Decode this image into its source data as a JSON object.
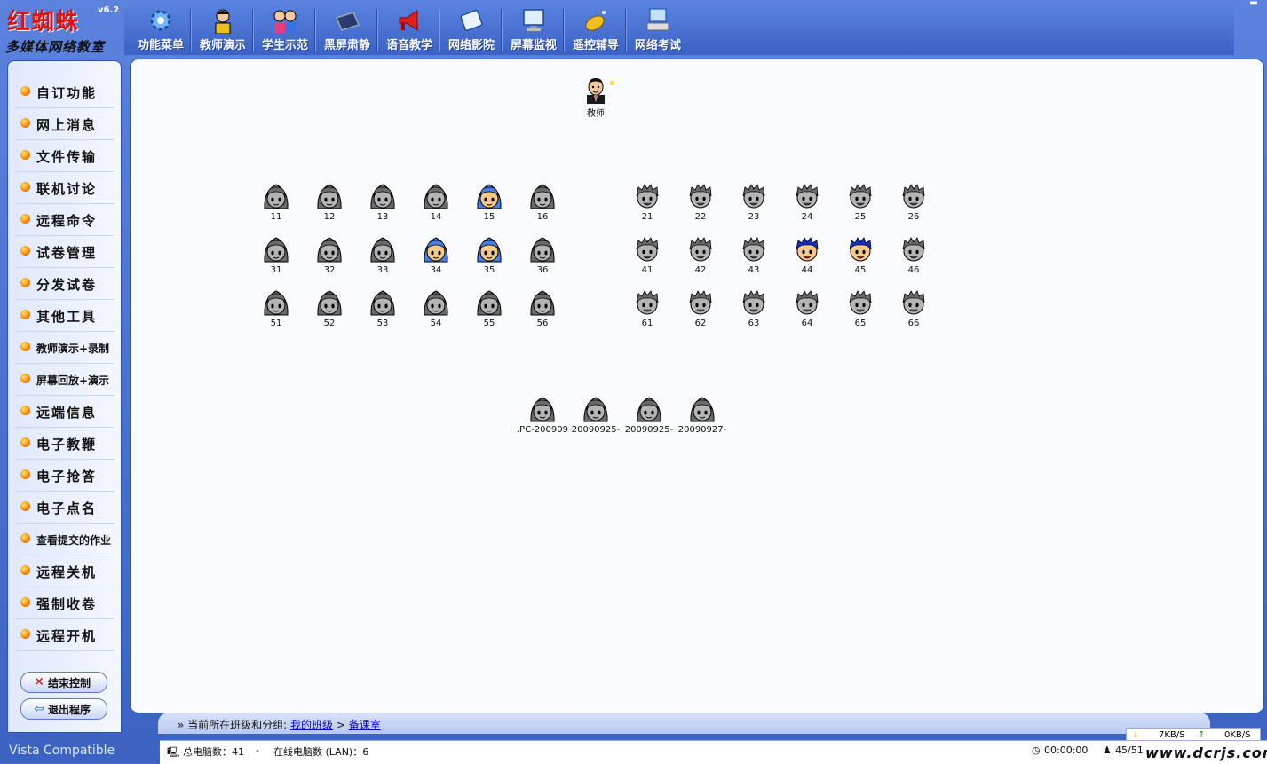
{
  "app": {
    "title": "红蜘蛛",
    "version": "v6.2",
    "subtitle": "多媒体网络教室",
    "footer": "Vista Compatible"
  },
  "toolbar": [
    {
      "label": "功能菜单",
      "icon": "gear-icon"
    },
    {
      "label": "教师演示",
      "icon": "teacher-icon"
    },
    {
      "label": "学生示范",
      "icon": "students-icon"
    },
    {
      "label": "黑屏肃静",
      "icon": "black-screen-icon"
    },
    {
      "label": "语音教学",
      "icon": "megaphone-icon"
    },
    {
      "label": "网络影院",
      "icon": "film-icon"
    },
    {
      "label": "屏幕监视",
      "icon": "monitor-icon"
    },
    {
      "label": "遥控辅导",
      "icon": "satellite-icon"
    },
    {
      "label": "网络考试",
      "icon": "exam-computer-icon"
    }
  ],
  "sidebar": {
    "items": [
      {
        "label": "自订功能",
        "small": false
      },
      {
        "label": "网上消息",
        "small": false
      },
      {
        "label": "文件传输",
        "small": false
      },
      {
        "label": "联机讨论",
        "small": false
      },
      {
        "label": "远程命令",
        "small": false
      },
      {
        "label": "试卷管理",
        "small": false
      },
      {
        "label": "分发试卷",
        "small": false
      },
      {
        "label": "其他工具",
        "small": false
      },
      {
        "label": "教师演示+录制",
        "small": true
      },
      {
        "label": "屏幕回放+演示",
        "small": true
      },
      {
        "label": "远端信息",
        "small": false
      },
      {
        "label": "电子教鞭",
        "small": false
      },
      {
        "label": "电子抢答",
        "small": false
      },
      {
        "label": "电子点名",
        "small": false
      },
      {
        "label": "查看提交的作业",
        "small": true
      },
      {
        "label": "远程关机",
        "small": false
      },
      {
        "label": "强制收卷",
        "small": false
      },
      {
        "label": "远程开机",
        "small": false
      }
    ],
    "end_button": "结束控制",
    "exit_button": "退出程序"
  },
  "teacher": {
    "label": "教师"
  },
  "desks": [
    {
      "label": "11",
      "type": "girl",
      "state": "offline"
    },
    {
      "label": "12",
      "type": "girl",
      "state": "offline"
    },
    {
      "label": "13",
      "type": "girl",
      "state": "offline"
    },
    {
      "label": "14",
      "type": "girl",
      "state": "offline"
    },
    {
      "label": "15",
      "type": "girl",
      "state": "online"
    },
    {
      "label": "16",
      "type": "girl",
      "state": "offline"
    },
    {
      "label": "31",
      "type": "girl",
      "state": "offline"
    },
    {
      "label": "32",
      "type": "girl",
      "state": "offline"
    },
    {
      "label": "33",
      "type": "girl",
      "state": "offline"
    },
    {
      "label": "34",
      "type": "girl",
      "state": "online"
    },
    {
      "label": "35",
      "type": "girl",
      "state": "online"
    },
    {
      "label": "36",
      "type": "girl",
      "state": "offline"
    },
    {
      "label": "51",
      "type": "girl",
      "state": "offline"
    },
    {
      "label": "52",
      "type": "girl",
      "state": "offline"
    },
    {
      "label": "53",
      "type": "girl",
      "state": "offline"
    },
    {
      "label": "54",
      "type": "girl",
      "state": "offline"
    },
    {
      "label": "55",
      "type": "girl",
      "state": "offline"
    },
    {
      "label": "56",
      "type": "girl",
      "state": "offline"
    },
    {
      "label": "21",
      "type": "boy",
      "state": "offline"
    },
    {
      "label": "22",
      "type": "boy",
      "state": "offline"
    },
    {
      "label": "23",
      "type": "boy",
      "state": "offline"
    },
    {
      "label": "24",
      "type": "boy",
      "state": "offline"
    },
    {
      "label": "25",
      "type": "boy",
      "state": "offline"
    },
    {
      "label": "26",
      "type": "boy",
      "state": "offline"
    },
    {
      "label": "41",
      "type": "boy",
      "state": "offline"
    },
    {
      "label": "42",
      "type": "boy",
      "state": "offline"
    },
    {
      "label": "43",
      "type": "boy",
      "state": "offline"
    },
    {
      "label": "44",
      "type": "boy",
      "state": "online"
    },
    {
      "label": "45",
      "type": "boy",
      "state": "online"
    },
    {
      "label": "46",
      "type": "boy",
      "state": "offline"
    },
    {
      "label": "61",
      "type": "boy",
      "state": "offline"
    },
    {
      "label": "62",
      "type": "boy",
      "state": "offline"
    },
    {
      "label": "63",
      "type": "boy",
      "state": "offline"
    },
    {
      "label": "64",
      "type": "boy",
      "state": "offline"
    },
    {
      "label": "65",
      "type": "boy",
      "state": "offline"
    },
    {
      "label": "66",
      "type": "boy",
      "state": "offline"
    },
    {
      "label": ".PC-200909",
      "type": "girl",
      "state": "offline"
    },
    {
      "label": "20090925-",
      "type": "girl",
      "state": "offline"
    },
    {
      "label": "20090925-",
      "type": "girl",
      "state": "offline"
    },
    {
      "label": "20090927-",
      "type": "girl",
      "state": "offline"
    }
  ],
  "breadcrumb": {
    "prefix": "» 当前所在班级和分组:",
    "class_link": "我的班级",
    "sep": ">",
    "group_link": "备课室"
  },
  "status": {
    "total_label": "总电脑数：41",
    "dash": "-",
    "online_label": "在线电脑数 (LAN)：6",
    "timer": "00:00:00",
    "users": "45/51",
    "down_speed": "7KB/S",
    "up_speed": "0KB/S",
    "watermark": "www.dcrjs.com"
  },
  "colors": {
    "brand_red": "#e01010",
    "online_girl": "#4a7fe0",
    "online_boy": "#1030d0",
    "offline": "#8a8a8a",
    "frame_blue": "#3d63c2"
  }
}
